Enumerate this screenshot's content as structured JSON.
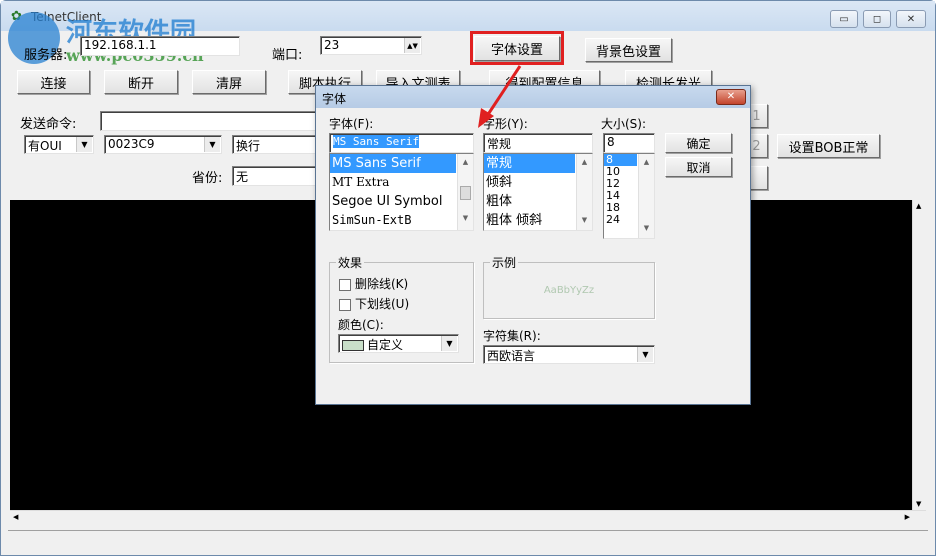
{
  "window": {
    "title": "TelnetClient",
    "minimize": "▭",
    "maximize": "◻",
    "close": "✕"
  },
  "watermark": {
    "name": "河东软件园",
    "url": "www.pc0359.cn"
  },
  "top": {
    "server_label": "服务器:",
    "server_value": "192.168.1.1",
    "port_label": "端口:",
    "port_value": "23",
    "font_settings": "字体设置",
    "bg_color_settings": "背景色设置"
  },
  "buttons": {
    "connect": "连接",
    "disconnect": "断开",
    "clear": "清屏",
    "script": "脚本执行",
    "import": "导入文测表",
    "get_config": "得到配置信息",
    "detect": "检测长发光",
    "btn1": "1",
    "btn2": "2",
    "btn3": "",
    "set_bob": "设置BOB正常"
  },
  "send": {
    "label": "发送命令:",
    "value": "",
    "oui": "有OUI",
    "code": "0023C9",
    "newline": "换行",
    "province_label": "省份:",
    "province": "无"
  },
  "dialog": {
    "title": "字体",
    "close": "✕",
    "font_label": "字体(F):",
    "font_value": "MS Sans Serif",
    "fonts": [
      "MS Sans Serif",
      "MT Extra",
      "Segoe UI Symbol",
      "SimSun-ExtB"
    ],
    "style_label": "字形(Y):",
    "style_value": "常规",
    "styles": [
      "常规",
      "倾斜",
      "粗体",
      "粗体 倾斜"
    ],
    "size_label": "大小(S):",
    "size_value": "8",
    "sizes": [
      "8",
      "10",
      "12",
      "14",
      "18",
      "24"
    ],
    "ok": "确定",
    "cancel": "取消",
    "effects_label": "效果",
    "strikeout": "删除线(K)",
    "underline": "下划线(U)",
    "color_label": "颜色(C):",
    "color_value": "自定义",
    "color_swatch": "#c9dfc9",
    "sample_label": "示例",
    "sample_text": "AaBbYyZz",
    "charset_label": "字符集(R):",
    "charset_value": "西欧语言"
  },
  "colors": {
    "highlight": "#3399ff",
    "annotation": "#e02020"
  }
}
